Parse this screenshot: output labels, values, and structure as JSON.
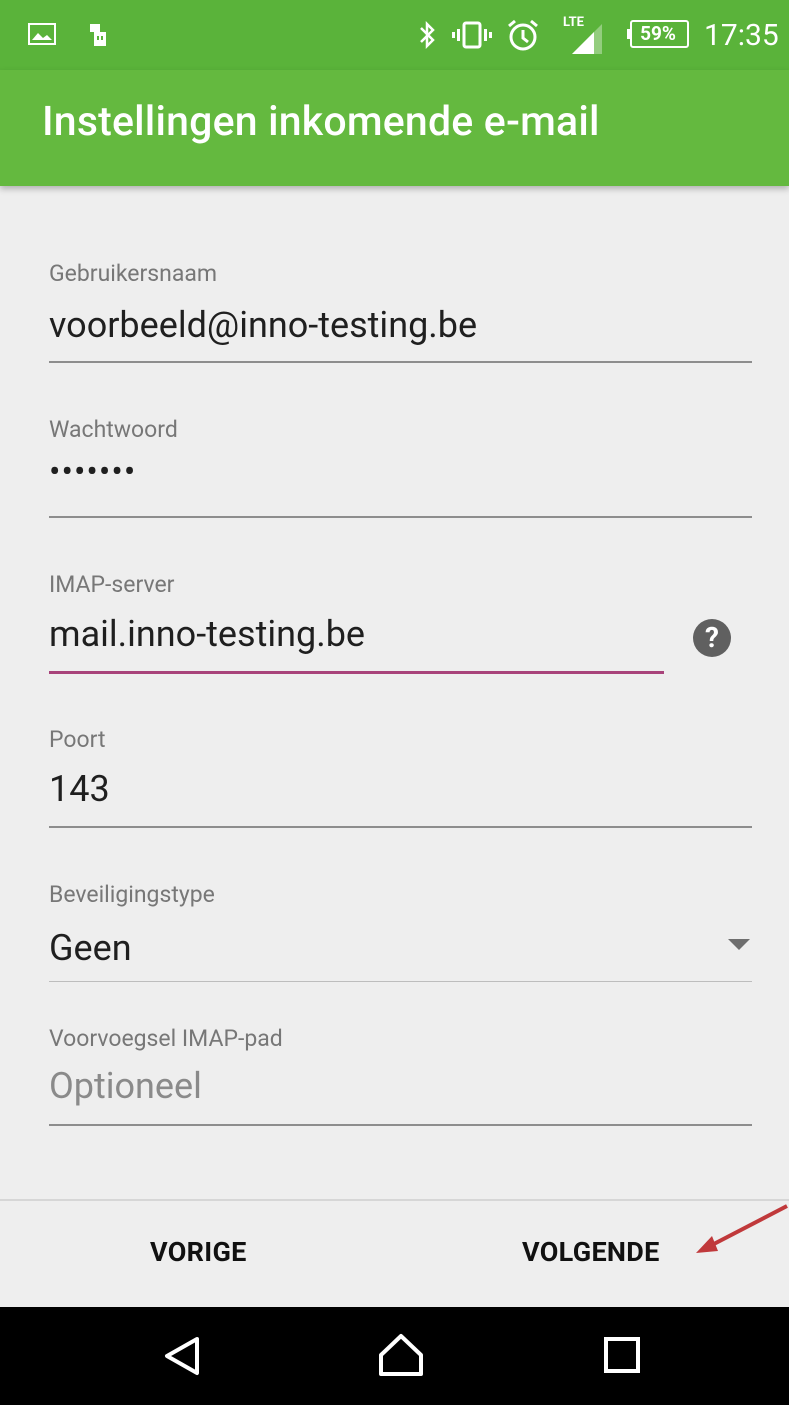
{
  "status_bar": {
    "time": "17:35",
    "battery_percent": "59%",
    "network": "LTE",
    "icons": [
      "image-icon",
      "usb-icon",
      "bluetooth-icon",
      "vibrate-icon",
      "alarm-icon",
      "signal-icon",
      "battery-icon"
    ]
  },
  "app_bar": {
    "title": "Instellingen inkomende e-mail",
    "color": "#64b93f"
  },
  "form": {
    "username": {
      "label": "Gebruikersnaam",
      "value": "voorbeeld@inno-testing.be"
    },
    "password": {
      "label": "Wachtwoord",
      "value": "•••••••"
    },
    "imap_server": {
      "label": "IMAP-server",
      "value": "mail.inno-testing.be",
      "accent_color": "#a8437a"
    },
    "port": {
      "label": "Poort",
      "value": "143"
    },
    "security_type": {
      "label": "Beveiligingstype",
      "value": "Geen"
    },
    "imap_path_prefix": {
      "label": "Voorvoegsel IMAP-pad",
      "placeholder": "Optioneel"
    }
  },
  "buttons": {
    "previous": "VORIGE",
    "next": "VOLGENDE"
  },
  "nav_bar": {
    "icons": [
      "back-icon",
      "home-icon",
      "recents-icon"
    ]
  },
  "annotation": {
    "arrow_color": "#c0393b",
    "points_to": "next-button"
  }
}
